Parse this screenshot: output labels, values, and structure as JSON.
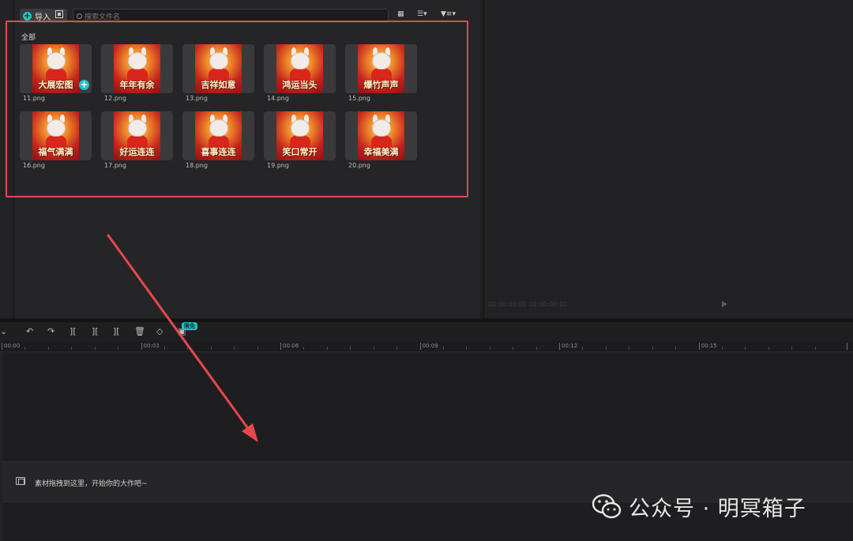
{
  "media": {
    "import_label": "导入",
    "search_placeholder": "搜索文件名",
    "section_label": "全部",
    "items": [
      {
        "caption": "大展宏图",
        "file": "11.png"
      },
      {
        "caption": "年年有余",
        "file": "12.png"
      },
      {
        "caption": "吉祥如意",
        "file": "13.png"
      },
      {
        "caption": "鸿运当头",
        "file": "14.png"
      },
      {
        "caption": "爆竹声声",
        "file": "15.png"
      },
      {
        "caption": "福气满满",
        "file": "16.png"
      },
      {
        "caption": "好运连连",
        "file": "17.png"
      },
      {
        "caption": "喜事连连",
        "file": "18.png"
      },
      {
        "caption": "笑口常开",
        "file": "19.png"
      },
      {
        "caption": "幸福美满",
        "file": "20.png"
      }
    ]
  },
  "preview": {
    "time": "00:00:00:00  00:00:00:00"
  },
  "timeline": {
    "badge": "限免",
    "ticks": [
      "00:00",
      "00:03",
      "00:06",
      "00:09",
      "00:12",
      "00:15"
    ],
    "drop_hint": "素材拖拽到这里，开始你的大作吧~"
  },
  "watermark": {
    "text": "公众号 · 明冥箱子"
  },
  "colors": {
    "accent": "#1fc1c6",
    "highlight": "#e04b50"
  }
}
